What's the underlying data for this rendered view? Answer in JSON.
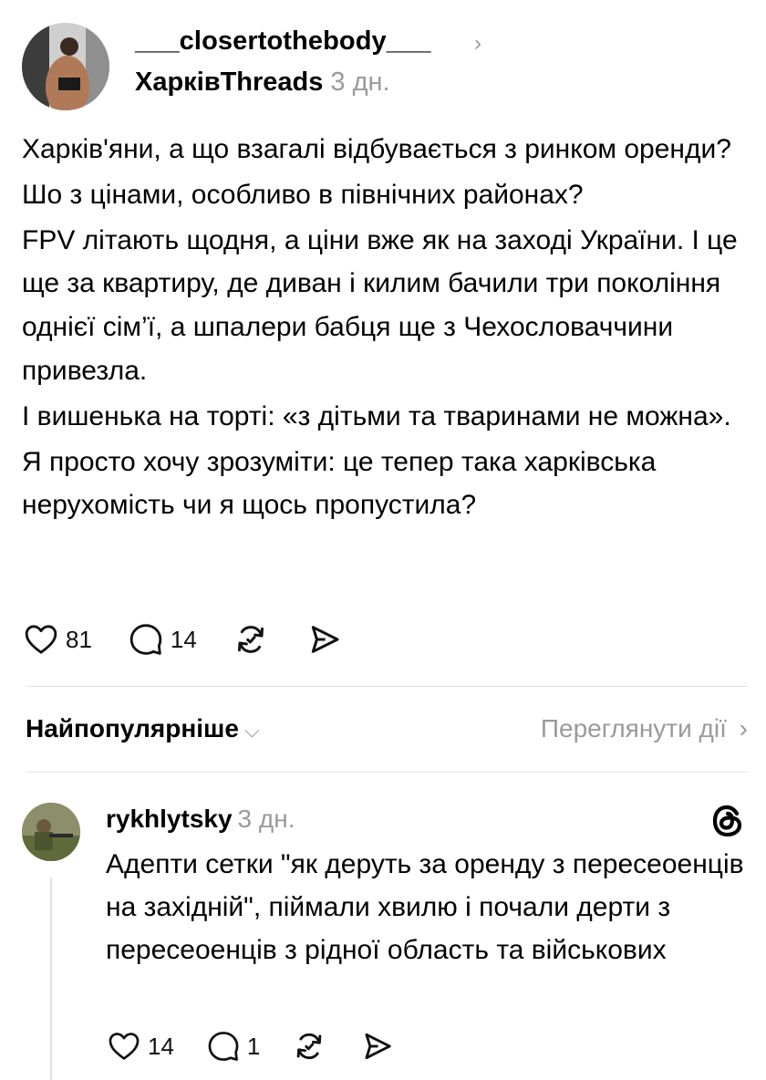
{
  "post": {
    "username": "___closertothebody___",
    "community": "ХарківThreads",
    "time": "3 дн.",
    "paragraphs": [
      "Харків'яни, а що взагалі відбувається з ринком оренди?",
      "Шо з цінами, особливо в північних районах?",
      "FPV літають щодня, а ціни вже як на заході України. І це ще за квартиру, де диван і килим бачили три покоління однієї сім’ї, а шпалери бабця ще з Чехословаччини привезла.",
      "І вишенька на торті: «з дітьми та тваринами не можна».",
      "Я просто хочу зрозуміти: це тепер така харківська нерухомість чи я щось пропустила?"
    ],
    "likes": "81",
    "comments": "14"
  },
  "sort": {
    "label": "Найпопулярніше",
    "view_activity": "Переглянути дії"
  },
  "reply": {
    "username": "rykhlytsky",
    "time": "3 дн.",
    "text": "Адепти сетки \"як деруть за оренду з пересеоенців на західній\", піймали хвилю і почали дерти з пересеоенців з рідної область та військових",
    "likes": "14",
    "comments": "1"
  },
  "icons": {
    "like": "heart-icon",
    "comment": "speech-bubble-icon",
    "repost": "repost-arrows-icon",
    "share": "paper-plane-icon",
    "chevron": "chevron-right-icon",
    "dropdown": "chevron-down-icon",
    "logo": "threads-logo-icon"
  }
}
